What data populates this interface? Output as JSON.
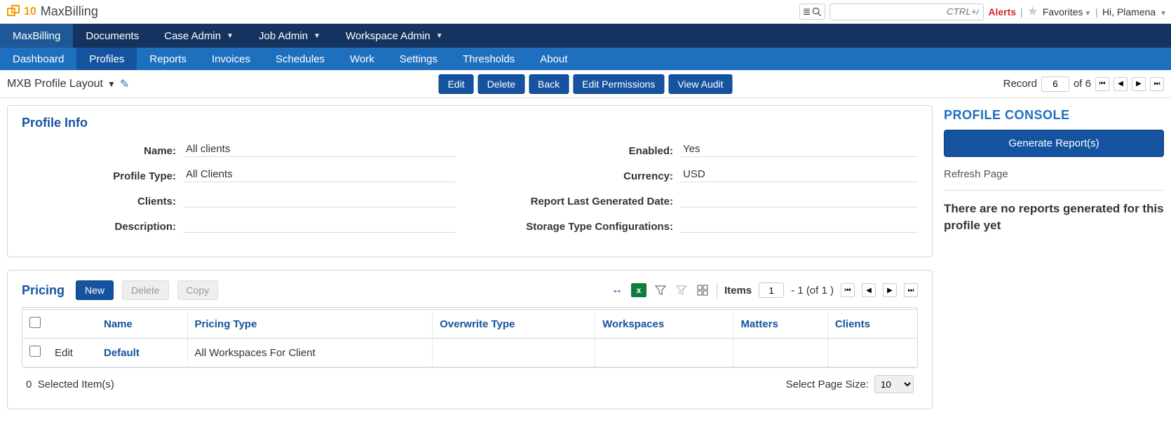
{
  "app": {
    "name": "MaxBilling",
    "logo10": "10"
  },
  "topbar": {
    "search_placeholder": "CTRL+/",
    "alerts": "Alerts",
    "favorites": "Favorites",
    "greeting": "Hi, Plamena"
  },
  "nav1": {
    "items": [
      {
        "label": "MaxBilling",
        "active": true,
        "caret": false
      },
      {
        "label": "Documents",
        "active": false,
        "caret": false
      },
      {
        "label": "Case Admin",
        "active": false,
        "caret": true
      },
      {
        "label": "Job Admin",
        "active": false,
        "caret": true
      },
      {
        "label": "Workspace Admin",
        "active": false,
        "caret": true
      }
    ]
  },
  "nav2": {
    "items": [
      {
        "label": "Dashboard",
        "active": false
      },
      {
        "label": "Profiles",
        "active": true
      },
      {
        "label": "Reports",
        "active": false
      },
      {
        "label": "Invoices",
        "active": false
      },
      {
        "label": "Schedules",
        "active": false
      },
      {
        "label": "Work",
        "active": false
      },
      {
        "label": "Settings",
        "active": false
      },
      {
        "label": "Thresholds",
        "active": false
      },
      {
        "label": "About",
        "active": false
      }
    ]
  },
  "toolbar": {
    "layout": "MXB Profile Layout",
    "buttons": {
      "edit": "Edit",
      "delete": "Delete",
      "back": "Back",
      "permissions": "Edit Permissions",
      "audit": "View Audit"
    },
    "record_label": "Record",
    "record_current": "6",
    "record_total": "of 6"
  },
  "profile_info": {
    "title": "Profile Info",
    "left": [
      {
        "label": "Name:",
        "value": "All clients"
      },
      {
        "label": "Profile Type:",
        "value": "All Clients"
      },
      {
        "label": "Clients:",
        "value": ""
      },
      {
        "label": "Description:",
        "value": ""
      }
    ],
    "right": [
      {
        "label": "Enabled:",
        "value": "Yes"
      },
      {
        "label": "Currency:",
        "value": "USD"
      },
      {
        "label": "Report Last Generated Date:",
        "value": ""
      },
      {
        "label": "Storage Type Configurations:",
        "value": ""
      }
    ]
  },
  "pricing": {
    "title": "Pricing",
    "new": "New",
    "delete": "Delete",
    "copy": "Copy",
    "items_label": "Items",
    "items_current": "1",
    "items_range": "- 1  (of  1 )",
    "columns": [
      "",
      "",
      "Name",
      "Pricing Type",
      "Overwrite Type",
      "Workspaces",
      "Matters",
      "Clients"
    ],
    "rows": [
      {
        "edit": "Edit",
        "name": "Default",
        "pricing_type": "All Workspaces For Client",
        "overwrite": "",
        "workspaces": "",
        "matters": "",
        "clients": ""
      }
    ],
    "selected_count": "0",
    "selected_label": "Selected Item(s)",
    "page_size_label": "Select Page Size:",
    "page_size": "10"
  },
  "console": {
    "title": "PROFILE CONSOLE",
    "generate": "Generate Report(s)",
    "refresh": "Refresh Page",
    "empty": "There are no reports generated for this profile yet"
  }
}
